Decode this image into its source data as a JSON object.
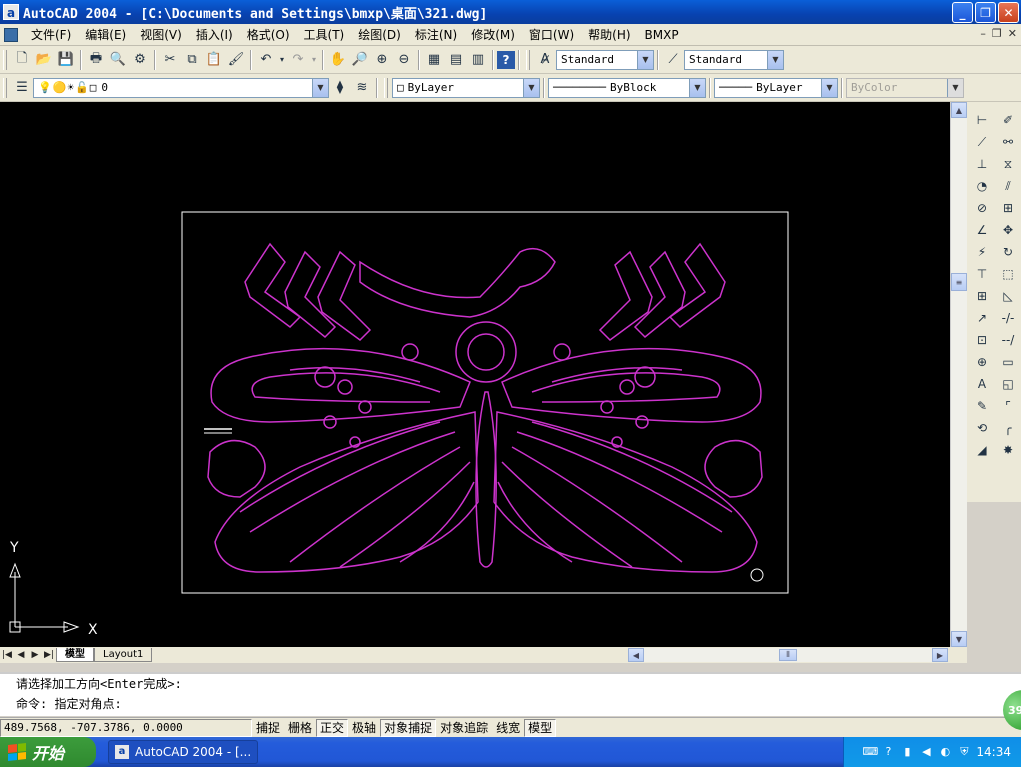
{
  "window": {
    "title": "AutoCAD 2004 - [C:\\Documents and Settings\\bmxp\\桌面\\321.dwg]",
    "app_icon": "a"
  },
  "menu": [
    "文件(F)",
    "编辑(E)",
    "视图(V)",
    "插入(I)",
    "格式(O)",
    "工具(T)",
    "绘图(D)",
    "标注(N)",
    "修改(M)",
    "窗口(W)",
    "帮助(H)",
    "BMXP"
  ],
  "toolbar": {
    "text_style": "Standard",
    "dim_style": "Standard"
  },
  "properties": {
    "layer": "0",
    "color": "ByLayer",
    "linetype": "ByBlock",
    "lineweight": "ByLayer",
    "plotstyle": "ByColor"
  },
  "canvas": {
    "ucs_y": "Y",
    "ucs_x": "X"
  },
  "tabs": [
    "模型",
    "Layout1"
  ],
  "command": {
    "line1": "请选择加工方向<Enter完成>:",
    "line2": "命令: 指定对角点:"
  },
  "status": {
    "coords": "489.7568, -707.3786, 0.0000",
    "buttons": [
      {
        "label": "捕捉",
        "on": false
      },
      {
        "label": "栅格",
        "on": false
      },
      {
        "label": "正交",
        "on": true
      },
      {
        "label": "极轴",
        "on": false
      },
      {
        "label": "对象捕捉",
        "on": true
      },
      {
        "label": "对象追踪",
        "on": false
      },
      {
        "label": "线宽",
        "on": false
      },
      {
        "label": "模型",
        "on": true
      }
    ]
  },
  "taskbar": {
    "start": "开始",
    "task": "AutoCAD 2004 - [...",
    "clock": "14:34",
    "badge": "39"
  },
  "colors": {
    "drawing_line": "#cc33cc",
    "canvas_bg": "#000000",
    "frame": "#ffffff"
  }
}
